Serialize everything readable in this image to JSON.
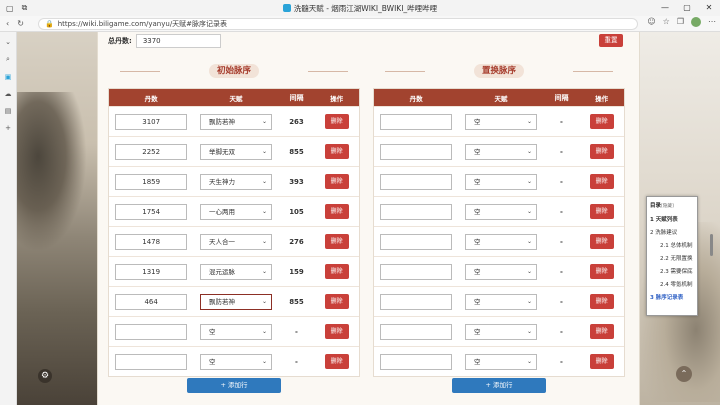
{
  "browser": {
    "title": "洗髓天赋 - 烟雨江湖WIKI_BWIKI_哔哩哔哩",
    "url": "https://wiki.biligame.com/yanyu/天赋#脉序记录表"
  },
  "total": {
    "label": "总丹数:",
    "value": "3370"
  },
  "reset_label": "重置",
  "left_section": {
    "title": "初始脉序",
    "headers": [
      "丹数",
      "天赋",
      "间隔",
      "操作"
    ],
    "rows": [
      {
        "dan": "3107",
        "talent": "飘防若神",
        "gap": "263",
        "action": "删除"
      },
      {
        "dan": "2252",
        "talent": "举脚无双",
        "gap": "855",
        "action": "删除"
      },
      {
        "dan": "1859",
        "talent": "天生神力",
        "gap": "393",
        "action": "删除"
      },
      {
        "dan": "1754",
        "talent": "一心两用",
        "gap": "105",
        "action": "删除"
      },
      {
        "dan": "1478",
        "talent": "天人合一",
        "gap": "276",
        "action": "删除"
      },
      {
        "dan": "1319",
        "talent": "混元运脉",
        "gap": "159",
        "action": "删除"
      },
      {
        "dan": "464",
        "talent": "飘防若神",
        "gap": "855",
        "action": "删除"
      },
      {
        "dan": "",
        "talent": "空",
        "gap": "-",
        "action": "删除"
      },
      {
        "dan": "",
        "talent": "空",
        "gap": "-",
        "action": "删除"
      }
    ],
    "add_label": "+ 添加行"
  },
  "right_section": {
    "title": "置换脉序",
    "headers": [
      "丹数",
      "天赋",
      "间隔",
      "操作"
    ],
    "rows": [
      {
        "dan": "",
        "talent": "空",
        "gap": "-",
        "action": "删除"
      },
      {
        "dan": "",
        "talent": "空",
        "gap": "-",
        "action": "删除"
      },
      {
        "dan": "",
        "talent": "空",
        "gap": "-",
        "action": "删除"
      },
      {
        "dan": "",
        "talent": "空",
        "gap": "-",
        "action": "删除"
      },
      {
        "dan": "",
        "talent": "空",
        "gap": "-",
        "action": "删除"
      },
      {
        "dan": "",
        "talent": "空",
        "gap": "-",
        "action": "删除"
      },
      {
        "dan": "",
        "talent": "空",
        "gap": "-",
        "action": "删除"
      },
      {
        "dan": "",
        "talent": "空",
        "gap": "-",
        "action": "删除"
      },
      {
        "dan": "",
        "talent": "空",
        "gap": "-",
        "action": "删除"
      }
    ],
    "add_label": "+ 添加行"
  },
  "toc": {
    "title": "目录",
    "title_action": "[隐藏]",
    "items": [
      {
        "num": "1",
        "label": "天赋列表"
      },
      {
        "num": "2",
        "label": "洗脉建议"
      },
      {
        "num": "2.1",
        "label": "总体机制"
      },
      {
        "num": "2.2",
        "label": "无限置换"
      },
      {
        "num": "2.3",
        "label": "需要保底"
      },
      {
        "num": "2.4",
        "label": "零氪机制"
      },
      {
        "num": "3",
        "label": "脉序记录表"
      }
    ]
  },
  "colors": {
    "header_red": "#a2432f",
    "delete_red": "#c9403a",
    "add_blue": "#2f79bd",
    "title_red": "#a53a2a"
  }
}
